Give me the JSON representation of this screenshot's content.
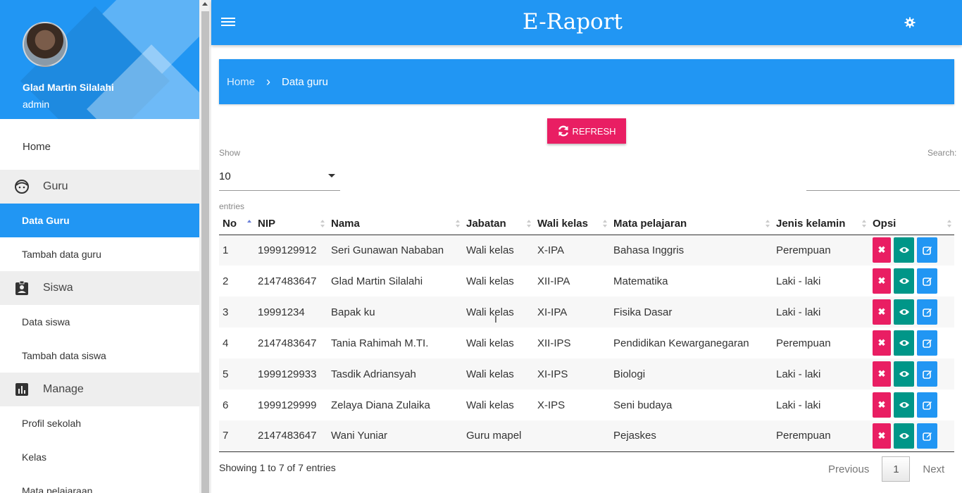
{
  "sidebar": {
    "profile_name": "Glad Martin Silalahi",
    "profile_role": "admin",
    "items": [
      {
        "label": "Home",
        "kind": "home"
      },
      {
        "label": "Guru",
        "kind": "section",
        "icon": "face-icon"
      },
      {
        "label": "Data Guru",
        "kind": "sub",
        "active": true
      },
      {
        "label": "Tambah data guru",
        "kind": "sub"
      },
      {
        "label": "Siswa",
        "kind": "section",
        "icon": "badge-icon"
      },
      {
        "label": "Data siswa",
        "kind": "sub"
      },
      {
        "label": "Tambah data siswa",
        "kind": "sub"
      },
      {
        "label": "Manage",
        "kind": "section",
        "icon": "chart-icon"
      },
      {
        "label": "Profil sekolah",
        "kind": "sub"
      },
      {
        "label": "Kelas",
        "kind": "sub"
      },
      {
        "label": "Mata pelajaraan",
        "kind": "sub"
      }
    ]
  },
  "header": {
    "title": "E-Raport"
  },
  "breadcrumb": {
    "home": "Home",
    "current": "Data guru"
  },
  "refresh_label": "REFRESH",
  "controls": {
    "show_label": "Show",
    "show_value": "10",
    "entries_label": "entries",
    "search_label": "Search:",
    "search_value": ""
  },
  "table": {
    "columns": [
      "No",
      "NIP",
      "Nama",
      "Jabatan",
      "Wali kelas",
      "Mata pelajaran",
      "Jenis kelamin",
      "Opsi"
    ],
    "rows": [
      [
        "1",
        "1999129912",
        "Seri Gunawan Nababan",
        "Wali kelas",
        "X-IPA",
        "Bahasa Inggris",
        "Perempuan"
      ],
      [
        "2",
        "2147483647",
        "Glad Martin Silalahi",
        "Wali kelas",
        "XII-IPA",
        "Matematika",
        "Laki - laki"
      ],
      [
        "3",
        "19991234",
        "Bapak ku",
        "Wali kelas",
        "XI-IPA",
        "Fisika Dasar",
        "Laki - laki"
      ],
      [
        "4",
        "2147483647",
        "Tania Rahimah M.TI.",
        "Wali kelas",
        "XII-IPS",
        "Pendidikan Kewarganegaran",
        "Perempuan"
      ],
      [
        "5",
        "1999129933",
        "Tasdik Adriansyah",
        "Wali kelas",
        "XI-IPS",
        "Biologi",
        "Laki - laki"
      ],
      [
        "6",
        "1999129999",
        "Zelaya Diana Zulaika",
        "Wali kelas",
        "X-IPS",
        "Seni budaya",
        "Laki - laki"
      ],
      [
        "7",
        "2147483647",
        "Wani Yuniar",
        "Guru mapel",
        "",
        "Pejaskes",
        "Perempuan"
      ]
    ]
  },
  "footer": {
    "info": "Showing 1 to 7 of 7 entries",
    "previous": "Previous",
    "page": "1",
    "next": "Next"
  },
  "colors": {
    "primary": "#2196f3",
    "danger": "#e91e63",
    "teal": "#009688"
  }
}
